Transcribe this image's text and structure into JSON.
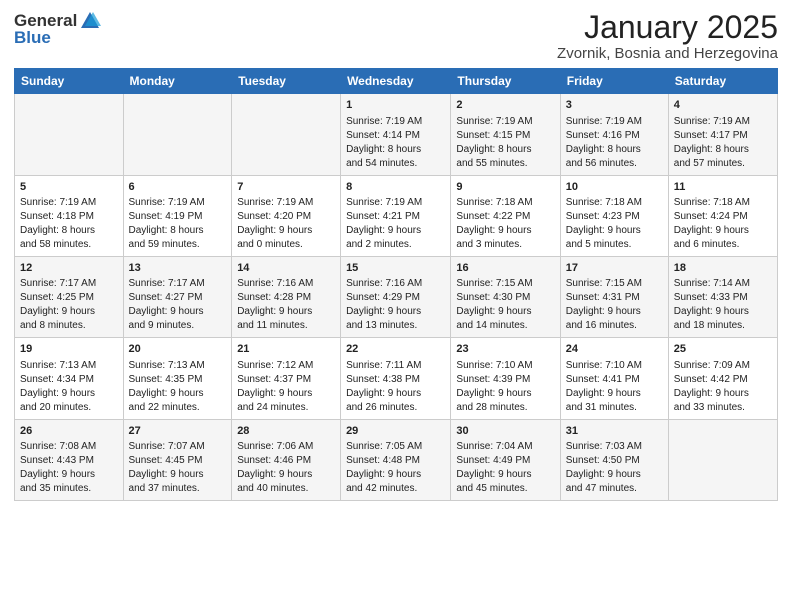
{
  "logo": {
    "general": "General",
    "blue": "Blue"
  },
  "header": {
    "month": "January 2025",
    "location": "Zvornik, Bosnia and Herzegovina"
  },
  "weekdays": [
    "Sunday",
    "Monday",
    "Tuesday",
    "Wednesday",
    "Thursday",
    "Friday",
    "Saturday"
  ],
  "weeks": [
    [
      {
        "day": "",
        "content": ""
      },
      {
        "day": "",
        "content": ""
      },
      {
        "day": "",
        "content": ""
      },
      {
        "day": "1",
        "content": "Sunrise: 7:19 AM\nSunset: 4:14 PM\nDaylight: 8 hours\nand 54 minutes."
      },
      {
        "day": "2",
        "content": "Sunrise: 7:19 AM\nSunset: 4:15 PM\nDaylight: 8 hours\nand 55 minutes."
      },
      {
        "day": "3",
        "content": "Sunrise: 7:19 AM\nSunset: 4:16 PM\nDaylight: 8 hours\nand 56 minutes."
      },
      {
        "day": "4",
        "content": "Sunrise: 7:19 AM\nSunset: 4:17 PM\nDaylight: 8 hours\nand 57 minutes."
      }
    ],
    [
      {
        "day": "5",
        "content": "Sunrise: 7:19 AM\nSunset: 4:18 PM\nDaylight: 8 hours\nand 58 minutes."
      },
      {
        "day": "6",
        "content": "Sunrise: 7:19 AM\nSunset: 4:19 PM\nDaylight: 8 hours\nand 59 minutes."
      },
      {
        "day": "7",
        "content": "Sunrise: 7:19 AM\nSunset: 4:20 PM\nDaylight: 9 hours\nand 0 minutes."
      },
      {
        "day": "8",
        "content": "Sunrise: 7:19 AM\nSunset: 4:21 PM\nDaylight: 9 hours\nand 2 minutes."
      },
      {
        "day": "9",
        "content": "Sunrise: 7:18 AM\nSunset: 4:22 PM\nDaylight: 9 hours\nand 3 minutes."
      },
      {
        "day": "10",
        "content": "Sunrise: 7:18 AM\nSunset: 4:23 PM\nDaylight: 9 hours\nand 5 minutes."
      },
      {
        "day": "11",
        "content": "Sunrise: 7:18 AM\nSunset: 4:24 PM\nDaylight: 9 hours\nand 6 minutes."
      }
    ],
    [
      {
        "day": "12",
        "content": "Sunrise: 7:17 AM\nSunset: 4:25 PM\nDaylight: 9 hours\nand 8 minutes."
      },
      {
        "day": "13",
        "content": "Sunrise: 7:17 AM\nSunset: 4:27 PM\nDaylight: 9 hours\nand 9 minutes."
      },
      {
        "day": "14",
        "content": "Sunrise: 7:16 AM\nSunset: 4:28 PM\nDaylight: 9 hours\nand 11 minutes."
      },
      {
        "day": "15",
        "content": "Sunrise: 7:16 AM\nSunset: 4:29 PM\nDaylight: 9 hours\nand 13 minutes."
      },
      {
        "day": "16",
        "content": "Sunrise: 7:15 AM\nSunset: 4:30 PM\nDaylight: 9 hours\nand 14 minutes."
      },
      {
        "day": "17",
        "content": "Sunrise: 7:15 AM\nSunset: 4:31 PM\nDaylight: 9 hours\nand 16 minutes."
      },
      {
        "day": "18",
        "content": "Sunrise: 7:14 AM\nSunset: 4:33 PM\nDaylight: 9 hours\nand 18 minutes."
      }
    ],
    [
      {
        "day": "19",
        "content": "Sunrise: 7:13 AM\nSunset: 4:34 PM\nDaylight: 9 hours\nand 20 minutes."
      },
      {
        "day": "20",
        "content": "Sunrise: 7:13 AM\nSunset: 4:35 PM\nDaylight: 9 hours\nand 22 minutes."
      },
      {
        "day": "21",
        "content": "Sunrise: 7:12 AM\nSunset: 4:37 PM\nDaylight: 9 hours\nand 24 minutes."
      },
      {
        "day": "22",
        "content": "Sunrise: 7:11 AM\nSunset: 4:38 PM\nDaylight: 9 hours\nand 26 minutes."
      },
      {
        "day": "23",
        "content": "Sunrise: 7:10 AM\nSunset: 4:39 PM\nDaylight: 9 hours\nand 28 minutes."
      },
      {
        "day": "24",
        "content": "Sunrise: 7:10 AM\nSunset: 4:41 PM\nDaylight: 9 hours\nand 31 minutes."
      },
      {
        "day": "25",
        "content": "Sunrise: 7:09 AM\nSunset: 4:42 PM\nDaylight: 9 hours\nand 33 minutes."
      }
    ],
    [
      {
        "day": "26",
        "content": "Sunrise: 7:08 AM\nSunset: 4:43 PM\nDaylight: 9 hours\nand 35 minutes."
      },
      {
        "day": "27",
        "content": "Sunrise: 7:07 AM\nSunset: 4:45 PM\nDaylight: 9 hours\nand 37 minutes."
      },
      {
        "day": "28",
        "content": "Sunrise: 7:06 AM\nSunset: 4:46 PM\nDaylight: 9 hours\nand 40 minutes."
      },
      {
        "day": "29",
        "content": "Sunrise: 7:05 AM\nSunset: 4:48 PM\nDaylight: 9 hours\nand 42 minutes."
      },
      {
        "day": "30",
        "content": "Sunrise: 7:04 AM\nSunset: 4:49 PM\nDaylight: 9 hours\nand 45 minutes."
      },
      {
        "day": "31",
        "content": "Sunrise: 7:03 AM\nSunset: 4:50 PM\nDaylight: 9 hours\nand 47 minutes."
      },
      {
        "day": "",
        "content": ""
      }
    ]
  ]
}
